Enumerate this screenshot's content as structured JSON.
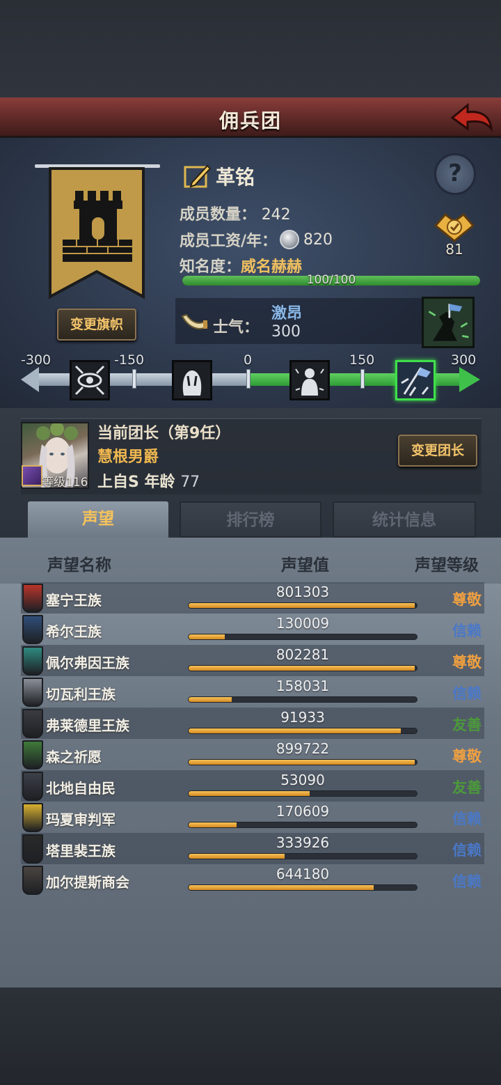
{
  "header": {
    "title": "佣兵团"
  },
  "guild": {
    "name": "革铭",
    "members_label": "成员数量：",
    "members_value": "242",
    "salary_label": "成员工资/年：",
    "salary_value": "820",
    "fame_label": "知名度：",
    "fame_value": "威名赫赫",
    "fame_progress": "100/100",
    "fame_fraction": 1.0,
    "badge_value": "81",
    "change_banner_label": "变更旗帜"
  },
  "morale": {
    "label": "士气：",
    "state": "激昂",
    "value": "300",
    "scale_ticks": [
      "-300",
      "-150",
      "0",
      "150",
      "300"
    ]
  },
  "leader": {
    "title": "当前团长（第9任）",
    "name": "慧根男爵",
    "level_text": "等级116",
    "info_prefix": "上自S  年龄",
    "age": "77",
    "change_leader_label": "变更团长"
  },
  "tabs": [
    {
      "label": "声望",
      "active": true
    },
    {
      "label": "排行榜",
      "active": false
    },
    {
      "label": "统计信息",
      "active": false
    }
  ],
  "reputation": {
    "headers": {
      "name": "声望名称",
      "value": "声望值",
      "level": "声望等级"
    },
    "rows": [
      {
        "name": "塞宁王族",
        "value": "801303",
        "fill": 0.99,
        "level": "尊敬",
        "level_color": "#f0a040",
        "icon_color": "#b8352c"
      },
      {
        "name": "希尔王族",
        "value": "130009",
        "fill": 0.16,
        "level": "信赖",
        "level_color": "#4a78c8",
        "icon_color": "#2f4e78"
      },
      {
        "name": "佩尔弗因王族",
        "value": "802281",
        "fill": 0.99,
        "level": "尊敬",
        "level_color": "#f0a040",
        "icon_color": "#2f8a80"
      },
      {
        "name": "切瓦利王族",
        "value": "158031",
        "fill": 0.19,
        "level": "信赖",
        "level_color": "#4a78c8",
        "icon_color": "#8a8f98"
      },
      {
        "name": "弗莱德里王族",
        "value": "91933",
        "fill": 0.93,
        "level": "友善",
        "level_color": "#4c9a3a",
        "icon_color": "#3a3c42"
      },
      {
        "name": "森之祈愿",
        "value": "899722",
        "fill": 0.99,
        "level": "尊敬",
        "level_color": "#f0a040",
        "icon_color": "#3f7a3a"
      },
      {
        "name": "北地自由民",
        "value": "53090",
        "fill": 0.53,
        "level": "友善",
        "level_color": "#4c9a3a",
        "icon_color": "#3c4048"
      },
      {
        "name": "玛夏审判军",
        "value": "170609",
        "fill": 0.21,
        "level": "信赖",
        "level_color": "#4a78c8",
        "icon_color": "#d8b030"
      },
      {
        "name": "塔里裴王族",
        "value": "333926",
        "fill": 0.42,
        "level": "信赖",
        "level_color": "#4a78c8",
        "icon_color": "#2a2a2a"
      },
      {
        "name": "加尔提斯商会",
        "value": "644180",
        "fill": 0.81,
        "level": "信赖",
        "level_color": "#4a78c8",
        "icon_color": "#4a4440"
      }
    ]
  }
}
